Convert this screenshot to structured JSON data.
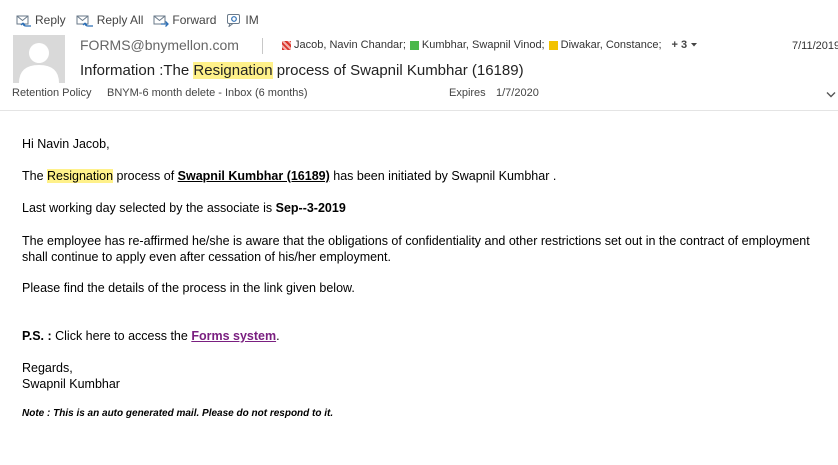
{
  "toolbar": {
    "reply": "Reply",
    "reply_all": "Reply All",
    "forward": "Forward",
    "im": "IM"
  },
  "header": {
    "from": "FORMS@bnymellon.com",
    "recipients": [
      {
        "name": "Jacob, Navin Chandar;",
        "color": "#d9342b"
      },
      {
        "name": "Kumbhar, Swapnil Vinod;",
        "color": "#4cb84c"
      },
      {
        "name": "Diwakar, Constance;",
        "color": "#f2c200"
      }
    ],
    "more": "+ 3",
    "date": "7/11/2019",
    "subject_prefix": "Information :The ",
    "subject_highlight": "Resignation",
    "subject_suffix": " process of Swapnil Kumbhar (16189)",
    "retention_label": "Retention Policy",
    "retention_value": "BNYM-6 month delete - Inbox (6 months)",
    "expires_label": "Expires",
    "expires_value": "1/7/2020"
  },
  "message": {
    "greeting": "Hi Navin Jacob,",
    "p1_a": "The ",
    "p1_highlight": "Resignation",
    "p1_b": " process of ",
    "p1_name": "Swapnil Kumbhar (16189)",
    "p1_c": " has been initiated by Swapnil Kumbhar .",
    "p2_a": "Last working day selected by the associate is ",
    "p2_date": "Sep--3-2019",
    "p3": "The employee has re-affirmed he/she is aware that the obligations of confidentiality and other restrictions set out in the contract of employment shall continue to apply even after cessation of his/her employment.",
    "p4": "Please find the details of the process in the link given below.",
    "ps_label": "P.S. :",
    "ps_text": " Click here to access the ",
    "ps_link": "Forms system",
    "ps_end": ".",
    "regards": "Regards,",
    "signature": "Swapnil Kumbhar",
    "note": "Note : This is an auto generated mail. Please do not respond to it."
  }
}
